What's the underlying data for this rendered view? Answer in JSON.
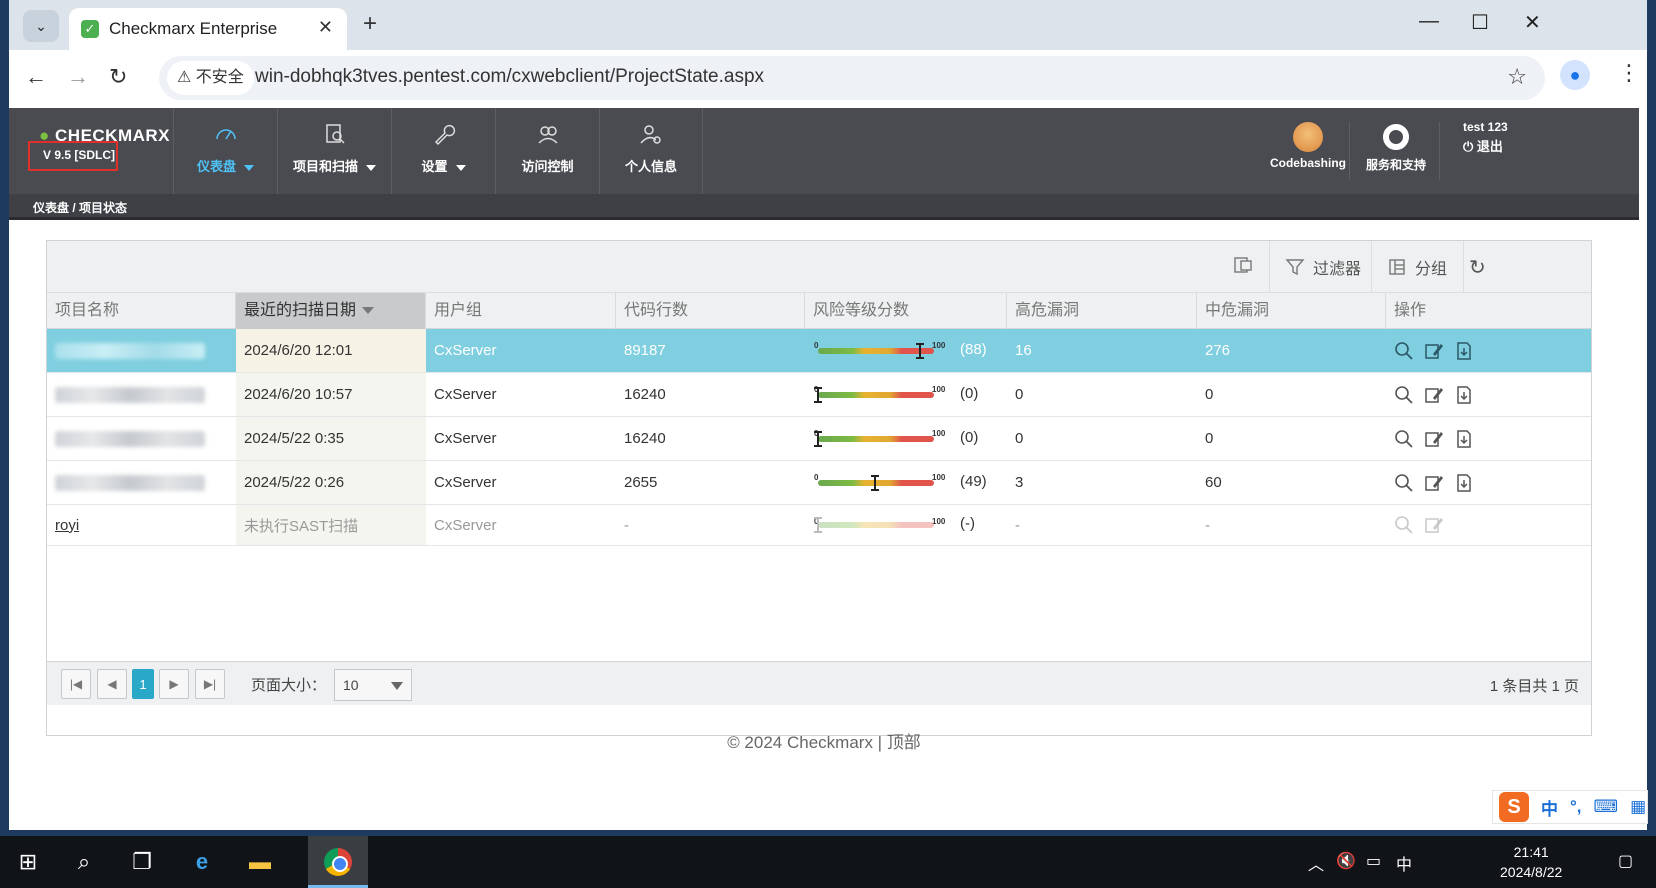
{
  "browser": {
    "tab_title": "Checkmarx Enterprise",
    "insecure_label": "不安全",
    "url": "win-dobhqk3tves.pentest.com/cxwebclient/ProjectState.aspx"
  },
  "header": {
    "logo_text": "CHECKMARX",
    "version": "V 9.5  [SDLC]",
    "nav": [
      {
        "label": "仪表盘",
        "icon": "dashboard-gauge-icon"
      },
      {
        "label": "项目和扫描",
        "icon": "project-search-icon"
      },
      {
        "label": "设置",
        "icon": "wrench-icon"
      },
      {
        "label": "访问控制",
        "icon": "users-icon"
      },
      {
        "label": "个人信息",
        "icon": "user-gear-icon"
      }
    ],
    "codebashing": "Codebashing",
    "support": "服务和支持",
    "user": "test 123",
    "logout": "退出"
  },
  "breadcrumb": "仪表盘 / 项目状态",
  "grid": {
    "toolbar": {
      "filter": "过滤器",
      "group": "分组"
    },
    "columns": [
      "项目名称",
      "最近的扫描日期",
      "用户组",
      "代码行数",
      "风险等级分数",
      "高危漏洞",
      "中危漏洞",
      "操作"
    ],
    "rows": [
      {
        "name": "",
        "date": "2024/6/20 12:01",
        "group": "CxServer",
        "loc": "89187",
        "risk": 88,
        "score": "(88)",
        "high": "16",
        "medium": "276",
        "selected": true
      },
      {
        "name": "",
        "date": "2024/6/20 10:57",
        "group": "CxServer",
        "loc": "16240",
        "risk": 0,
        "score": "(0)",
        "high": "0",
        "medium": "0"
      },
      {
        "name": "",
        "date": "2024/5/22 0:35",
        "group": "CxServer",
        "loc": "16240",
        "risk": 0,
        "score": "(0)",
        "high": "0",
        "medium": "0"
      },
      {
        "name": "",
        "date": "2024/5/22 0:26",
        "group": "CxServer",
        "loc": "2655",
        "risk": 49,
        "score": "(49)",
        "high": "3",
        "medium": "60"
      },
      {
        "name": "royi",
        "date": "未执行SAST扫描",
        "group": "CxServer",
        "loc": "-",
        "risk": 0,
        "score": "(-)",
        "high": "-",
        "medium": "-",
        "muted": true
      }
    ],
    "risk_min": "0",
    "risk_max": "100",
    "footer": {
      "page": "1",
      "page_size_label": "页面大小：",
      "page_size": "10",
      "page_info": "1 条目共 1 页"
    }
  },
  "copyright": "© 2024 Checkmarx | 顶部",
  "ime": {
    "lang": "中",
    "punct": "°,"
  },
  "taskbar": {
    "time": "21:41",
    "date": "2024/8/22",
    "ime_indicator": "中"
  }
}
